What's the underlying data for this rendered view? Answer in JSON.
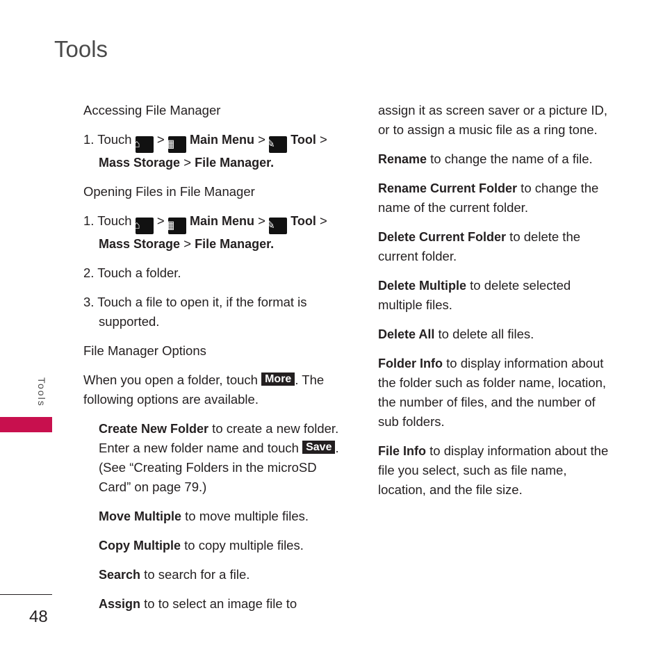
{
  "page_title": "Tools",
  "side_tab": "Tools",
  "page_number": "48",
  "icons": {
    "home": "home-icon",
    "menu": "main-menu-icon",
    "tool": "wrench-icon"
  },
  "left": {
    "s1_heading": "Accessing File Manager",
    "s1_step1_touch": "1. Touch",
    "sep": ">",
    "main_menu": "Main Menu",
    "tool": "Tool",
    "mass_storage": "Mass Storage",
    "file_manager": "File Manager.",
    "s2_heading": "Opening Files in File Manager",
    "s2_step2": "2. Touch a folder.",
    "s2_step3": "3. Touch a file to open it, if the format is supported.",
    "s3_heading": "File Manager Options",
    "intro_pre": "When you open a folder, touch",
    "more_btn": "More",
    "intro_post": ". The following options are available.",
    "opt_create_b": "Create New Folder",
    "opt_create_t1": " to create a new folder. Enter a new   folder name and touch",
    "save_btn": "Save",
    "opt_create_t2": ". (See “Creating Folders in the microSD Card” on page 79.)",
    "opt_move_b": "Move Multiple",
    "opt_move_t": " to move multiple files.",
    "opt_copy_b": "Copy Multiple",
    "opt_copy_t": " to copy multiple files.",
    "opt_search_b": "Search",
    "opt_search_t": " to search for a file.",
    "opt_assign_b": "Assign",
    "opt_assign_t": " to to select an image file to"
  },
  "right": {
    "assign_cont": "assign it as screen saver or a picture ID, or to assign a music file as a ring tone.",
    "items": [
      {
        "b": "Rename",
        "t": " to change the name of a file."
      },
      {
        "b": "Rename Current Folder",
        "t": " to change the name of the current folder."
      },
      {
        "b": "Delete Current Folder",
        "t": " to delete the current folder."
      },
      {
        "b": "Delete Multiple",
        "t": " to delete selected multiple files."
      },
      {
        "b": "Delete All",
        "t": " to delete all files."
      },
      {
        "b": "Folder Info",
        "t": " to display information about the folder such as folder name, location, the number of files, and the number of sub folders."
      },
      {
        "b": "File Info",
        "t": " to display information about the file you select, such as file name, location, and the file size."
      }
    ]
  }
}
